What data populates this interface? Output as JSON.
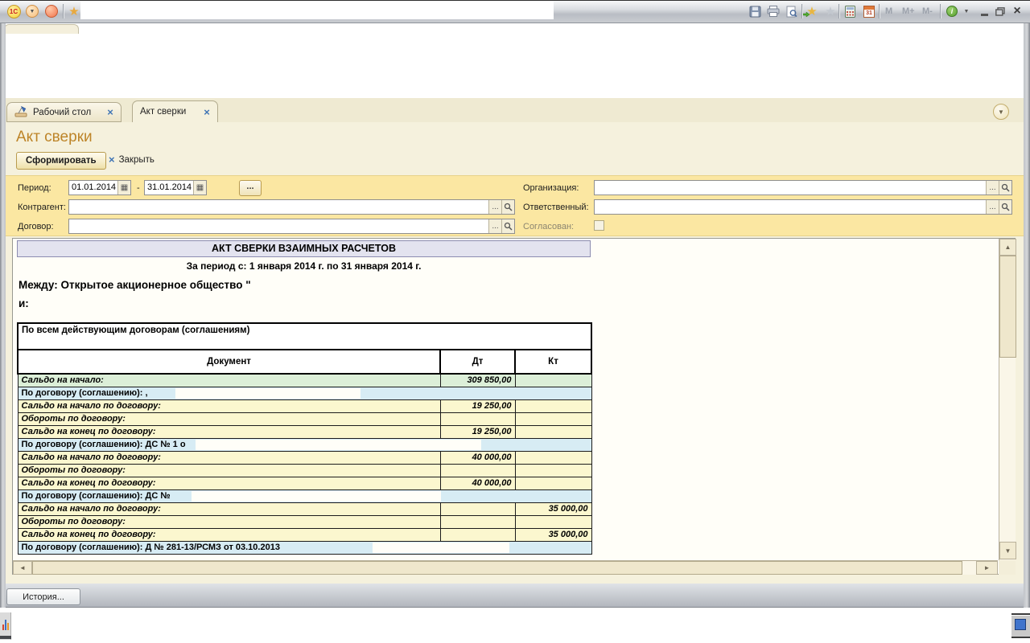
{
  "titlebar": {
    "app_badge": "1С",
    "left_icons": [
      "app-logo",
      "service-dropdown",
      "stop-button",
      "favorites-star"
    ],
    "right_icons": [
      "save",
      "print",
      "print-preview",
      "add-to-favorites",
      "favorites",
      "calculator",
      "calendar",
      "info"
    ],
    "memory_buttons": [
      "M",
      "M+",
      "M-"
    ],
    "window_buttons": [
      "minimize",
      "restore",
      "close"
    ]
  },
  "tabs": {
    "items": [
      {
        "label": "Рабочий стол"
      },
      {
        "label": "Акт сверки"
      }
    ],
    "active_index": 1
  },
  "page": {
    "title": "Акт сверки",
    "generate_button": "Сформировать",
    "close_button": "Закрыть"
  },
  "form": {
    "period": {
      "label": "Период:",
      "from": "01.01.2014",
      "separator": "-",
      "to": "31.01.2014"
    },
    "counterparty": {
      "label": "Контрагент:",
      "value": ""
    },
    "contract": {
      "label": "Договор:",
      "value": ""
    },
    "organization": {
      "label": "Организация:",
      "value": ""
    },
    "responsible": {
      "label": "Ответственный:",
      "value": ""
    },
    "approved": {
      "label": "Согласован:",
      "checked": false
    }
  },
  "report": {
    "title": "АКТ СВЕРКИ ВЗАИМНЫХ РАСЧЕТОВ",
    "period_line": "За период с: 1 января 2014 г. по 31 января 2014 г.",
    "between_line": "Между: Открытое акционерное общество \"",
    "and_line": "и:",
    "section_header": "По всем действующим договорам (соглашениям)",
    "columns": [
      "Документ",
      "Дт",
      "Кт"
    ],
    "rows": [
      {
        "label": "Сальдо на начало:",
        "dt": "309 850,00",
        "kt": "",
        "type": "green"
      },
      {
        "label": "По договору (соглашению): ,",
        "dt": "",
        "kt": "",
        "type": "blue"
      },
      {
        "label": "Сальдо на начало по договору:",
        "dt": "19 250,00",
        "kt": "",
        "type": "yellow"
      },
      {
        "label": "Обороты по договору:",
        "dt": "",
        "kt": "",
        "type": "yellow"
      },
      {
        "label": "Сальдо на конец по договору:",
        "dt": "19 250,00",
        "kt": "",
        "type": "yellow"
      },
      {
        "label": "По договору (соглашению): ДС № 1 о",
        "dt": "",
        "kt": "",
        "type": "blue"
      },
      {
        "label": "Сальдо на начало по договору:",
        "dt": "40 000,00",
        "kt": "",
        "type": "yellow"
      },
      {
        "label": "Обороты по договору:",
        "dt": "",
        "kt": "",
        "type": "yellow"
      },
      {
        "label": "Сальдо на конец по договору:",
        "dt": "40 000,00",
        "kt": "",
        "type": "yellow"
      },
      {
        "label": "По договору (соглашению): ДС №",
        "dt": "",
        "kt": "",
        "type": "blue"
      },
      {
        "label": "Сальдо на начало по договору:",
        "dt": "",
        "kt": "35 000,00",
        "type": "yellow"
      },
      {
        "label": "Обороты по договору:",
        "dt": "",
        "kt": "",
        "type": "yellow"
      },
      {
        "label": "Сальдо на конец по договору:",
        "dt": "",
        "kt": "35 000,00",
        "type": "yellow"
      },
      {
        "label": "По договору (соглашению): Д № 281-13/РСМЗ от 03.10.2013",
        "dt": "",
        "kt": "",
        "type": "blue"
      }
    ]
  },
  "statusbar": {
    "history_button": "История..."
  },
  "glyphs": {
    "calendar_grid": "▦",
    "ellipsis": "...",
    "scroll_up": "▲",
    "scroll_down": "▼",
    "scroll_left": "◄",
    "scroll_right": "►",
    "chevron_down": "▼",
    "close_x": "×",
    "star": "★"
  }
}
